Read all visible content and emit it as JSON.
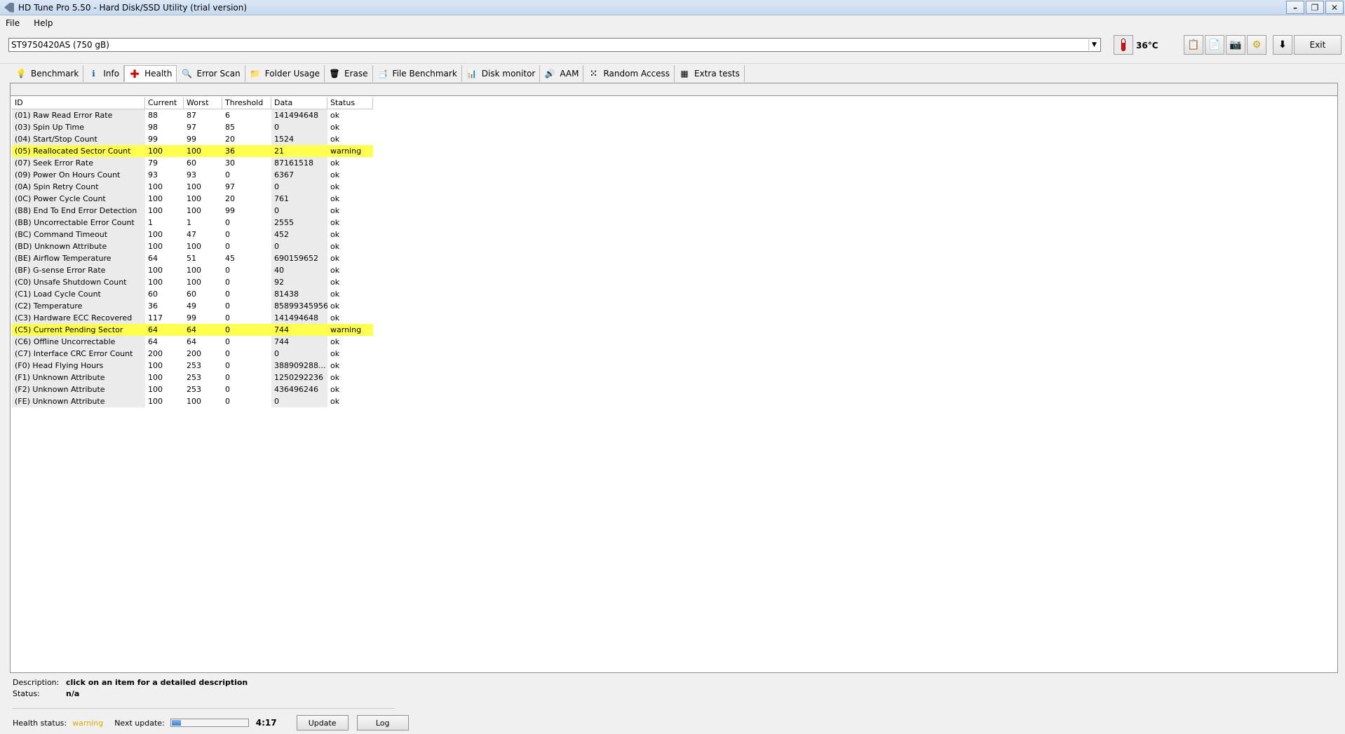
{
  "window": {
    "title": "HD Tune Pro 5.50 - Hard Disk/SSD Utility (trial version)"
  },
  "menu": [
    {
      "label": "File"
    },
    {
      "label": "Help"
    }
  ],
  "drive": {
    "selected": "ST9750420AS (750 gB)",
    "temperature": "36°C"
  },
  "toolbar": {
    "exit_label": "Exit",
    "icons": [
      "copy-info-icon",
      "copy-text-icon",
      "screenshot-icon",
      "options-icon",
      "save-icon"
    ]
  },
  "tabs": [
    {
      "label": "Benchmark",
      "icon": "benchmark-icon"
    },
    {
      "label": "Info",
      "icon": "info-icon"
    },
    {
      "label": "Health",
      "icon": "health-icon",
      "active": true
    },
    {
      "label": "Error Scan",
      "icon": "error-scan-icon"
    },
    {
      "label": "Folder Usage",
      "icon": "folder-icon"
    },
    {
      "label": "Erase",
      "icon": "trash-icon"
    },
    {
      "label": "File Benchmark",
      "icon": "file-benchmark-icon"
    },
    {
      "label": "Disk monitor",
      "icon": "disk-monitor-icon"
    },
    {
      "label": "AAM",
      "icon": "speaker-icon"
    },
    {
      "label": "Random Access",
      "icon": "random-access-icon"
    },
    {
      "label": "Extra tests",
      "icon": "extra-tests-icon"
    }
  ],
  "table": {
    "headers": [
      "ID",
      "Current",
      "Worst",
      "Threshold",
      "Data",
      "Status"
    ],
    "rows": [
      [
        "(01) Raw Read Error Rate",
        "88",
        "87",
        "6",
        "141494648",
        "ok"
      ],
      [
        "(03) Spin Up Time",
        "98",
        "97",
        "85",
        "0",
        "ok"
      ],
      [
        "(04) Start/Stop Count",
        "99",
        "99",
        "20",
        "1524",
        "ok"
      ],
      [
        "(05) Reallocated Sector Count",
        "100",
        "100",
        "36",
        "21",
        "warning"
      ],
      [
        "(07) Seek Error Rate",
        "79",
        "60",
        "30",
        "87161518",
        "ok"
      ],
      [
        "(09) Power On Hours Count",
        "93",
        "93",
        "0",
        "6367",
        "ok"
      ],
      [
        "(0A) Spin Retry Count",
        "100",
        "100",
        "97",
        "0",
        "ok"
      ],
      [
        "(0C) Power Cycle Count",
        "100",
        "100",
        "20",
        "761",
        "ok"
      ],
      [
        "(B8) End To End Error Detection",
        "100",
        "100",
        "99",
        "0",
        "ok"
      ],
      [
        "(BB) Uncorrectable Error Count",
        "1",
        "1",
        "0",
        "2555",
        "ok"
      ],
      [
        "(BC) Command Timeout",
        "100",
        "47",
        "0",
        "452",
        "ok"
      ],
      [
        "(BD) Unknown Attribute",
        "100",
        "100",
        "0",
        "0",
        "ok"
      ],
      [
        "(BE) Airflow Temperature",
        "64",
        "51",
        "45",
        "690159652",
        "ok"
      ],
      [
        "(BF) G-sense Error Rate",
        "100",
        "100",
        "0",
        "40",
        "ok"
      ],
      [
        "(C0) Unsafe Shutdown Count",
        "100",
        "100",
        "0",
        "92",
        "ok"
      ],
      [
        "(C1) Load Cycle Count",
        "60",
        "60",
        "0",
        "81438",
        "ok"
      ],
      [
        "(C2) Temperature",
        "36",
        "49",
        "0",
        "85899345956",
        "ok"
      ],
      [
        "(C3) Hardware ECC Recovered",
        "117",
        "99",
        "0",
        "141494648",
        "ok"
      ],
      [
        "(C5) Current Pending Sector",
        "64",
        "64",
        "0",
        "744",
        "warning"
      ],
      [
        "(C6) Offline Uncorrectable",
        "64",
        "64",
        "0",
        "744",
        "ok"
      ],
      [
        "(C7) Interface CRC Error Count",
        "200",
        "200",
        "0",
        "0",
        "ok"
      ],
      [
        "(F0) Head Flying Hours",
        "100",
        "253",
        "0",
        "388909288...",
        "ok"
      ],
      [
        "(F1) Unknown Attribute",
        "100",
        "253",
        "0",
        "1250292236",
        "ok"
      ],
      [
        "(F2) Unknown Attribute",
        "100",
        "253",
        "0",
        "436496246",
        "ok"
      ],
      [
        "(FE) Unknown Attribute",
        "100",
        "100",
        "0",
        "0",
        "ok"
      ]
    ]
  },
  "description": {
    "description_label": "Description:",
    "description_value": "click on an item for a detailed description",
    "status_label": "Status:",
    "status_value": "n/a"
  },
  "status_bar": {
    "health_label": "Health status:",
    "health_value": "warning",
    "next_update_label": "Next update:",
    "progress": 0.12,
    "timer": "4:17",
    "update_label": "Update",
    "log_label": "Log"
  }
}
